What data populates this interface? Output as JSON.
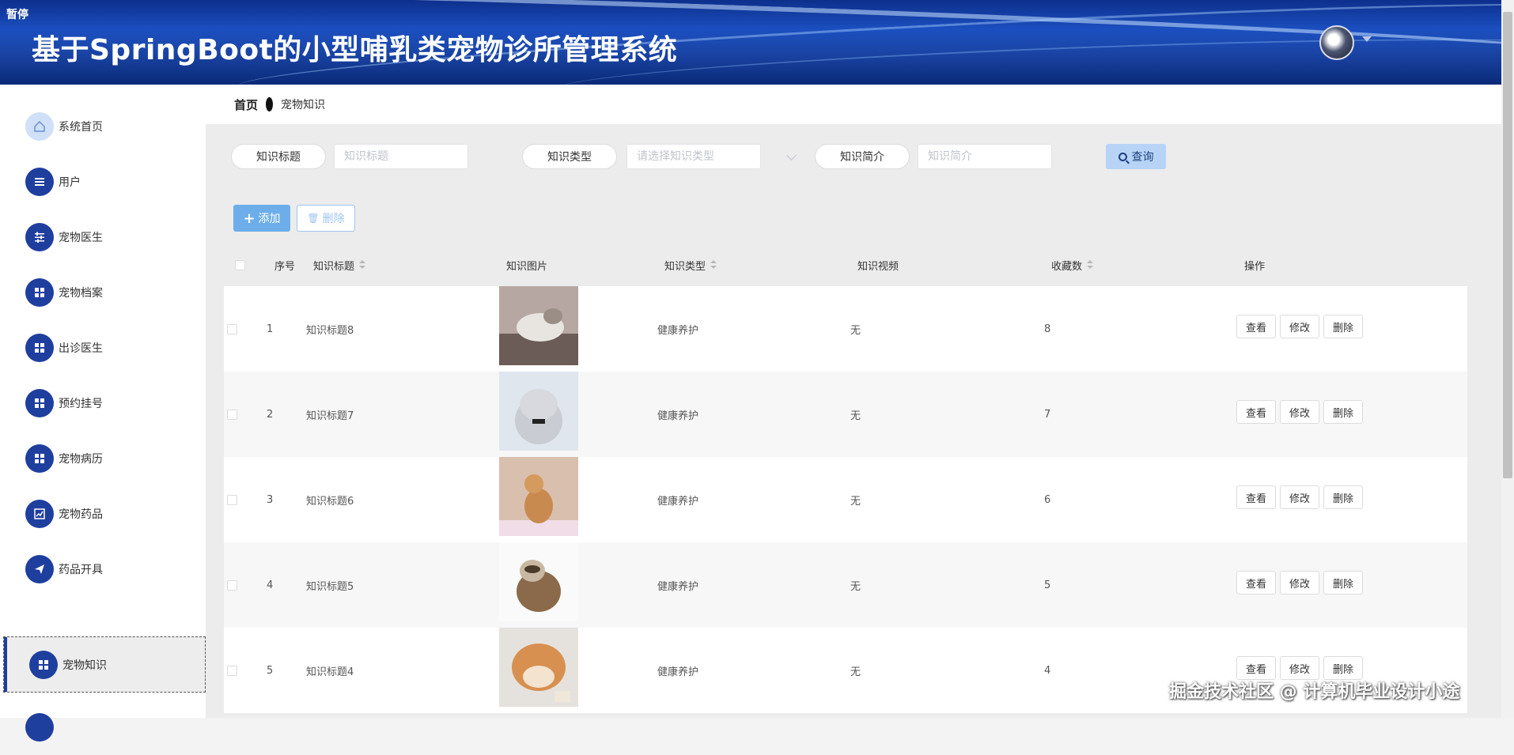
{
  "header": {
    "pause_label": "暂停",
    "title": "基于SpringBoot的小型哺乳类宠物诊所管理系统"
  },
  "breadcrumb": {
    "home": "首页",
    "current": "宠物知识"
  },
  "sidebar": {
    "items": [
      {
        "label": "系统首页",
        "icon": "home-icon"
      },
      {
        "label": "用户",
        "icon": "list-icon"
      },
      {
        "label": "宠物医生",
        "icon": "sliders-icon"
      },
      {
        "label": "宠物档案",
        "icon": "grid-icon"
      },
      {
        "label": "出诊医生",
        "icon": "grid-icon"
      },
      {
        "label": "预约挂号",
        "icon": "grid-icon"
      },
      {
        "label": "宠物病历",
        "icon": "grid-icon"
      },
      {
        "label": "宠物药品",
        "icon": "chart-icon"
      },
      {
        "label": "药品开具",
        "icon": "send-icon"
      },
      {
        "label": "宠物知识",
        "icon": "grid-icon",
        "active": true
      }
    ]
  },
  "search": {
    "title_label": "知识标题",
    "title_placeholder": "知识标题",
    "type_label": "知识类型",
    "type_placeholder": "请选择知识类型",
    "intro_label": "知识简介",
    "intro_placeholder": "知识简介",
    "query_button": "查询"
  },
  "actions": {
    "add": "添加",
    "delete": "删除"
  },
  "table": {
    "columns": [
      "序号",
      "知识标题",
      "知识图片",
      "知识类型",
      "知识视频",
      "收藏数",
      "操作"
    ],
    "rows": [
      {
        "index": "1",
        "title": "知识标题8",
        "type": "健康养护",
        "video": "无",
        "favorites": "8",
        "image": "cat-photo"
      },
      {
        "index": "2",
        "title": "知识标题7",
        "type": "健康养护",
        "video": "无",
        "favorites": "7",
        "image": "kitten-photo"
      },
      {
        "index": "3",
        "title": "知识标题6",
        "type": "健康养护",
        "video": "无",
        "favorites": "6",
        "image": "dog-photo"
      },
      {
        "index": "4",
        "title": "知识标题5",
        "type": "健康养护",
        "video": "无",
        "favorites": "5",
        "image": "ferret-photo"
      },
      {
        "index": "5",
        "title": "知识标题4",
        "type": "健康养护",
        "video": "无",
        "favorites": "4",
        "image": "shiba-photo"
      }
    ],
    "row_actions": {
      "view": "查看",
      "edit": "修改",
      "delete": "删除"
    }
  },
  "watermark": "掘金技术社区 @ 计算机毕业设计小途",
  "colors": {
    "primary": "#1f3f9e",
    "add_button": "#6daeea",
    "query_button": "#b7d4f7"
  }
}
